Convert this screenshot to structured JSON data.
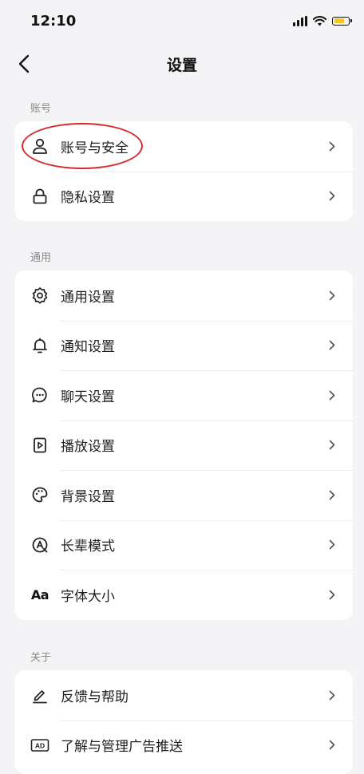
{
  "status_bar": {
    "time": "12:10",
    "battery_color": "#f3c623"
  },
  "nav": {
    "title": "设置",
    "back_icon": "chevron-left-icon"
  },
  "sections": [
    {
      "label": "账号",
      "items": [
        {
          "label": "账号与安全",
          "icon": "user-icon"
        },
        {
          "label": "隐私设置",
          "icon": "lock-icon"
        }
      ]
    },
    {
      "label": "通用",
      "items": [
        {
          "label": "通用设置",
          "icon": "gear-icon"
        },
        {
          "label": "通知设置",
          "icon": "bell-icon"
        },
        {
          "label": "聊天设置",
          "icon": "chat-bubble-icon"
        },
        {
          "label": "播放设置",
          "icon": "play-icon"
        },
        {
          "label": "背景设置",
          "icon": "palette-icon"
        },
        {
          "label": "长辈模式",
          "icon": "elder-mode-icon"
        },
        {
          "label": "字体大小",
          "icon": "font-size-icon",
          "icon_text": "Aa"
        }
      ]
    },
    {
      "label": "关于",
      "items": [
        {
          "label": "反馈与帮助",
          "icon": "edit-pen-icon"
        },
        {
          "label": "了解与管理广告推送",
          "icon": "ad-icon",
          "icon_text": "AD"
        }
      ]
    }
  ],
  "annotation": {
    "color": "#d62a2a",
    "target": "账号与安全"
  }
}
